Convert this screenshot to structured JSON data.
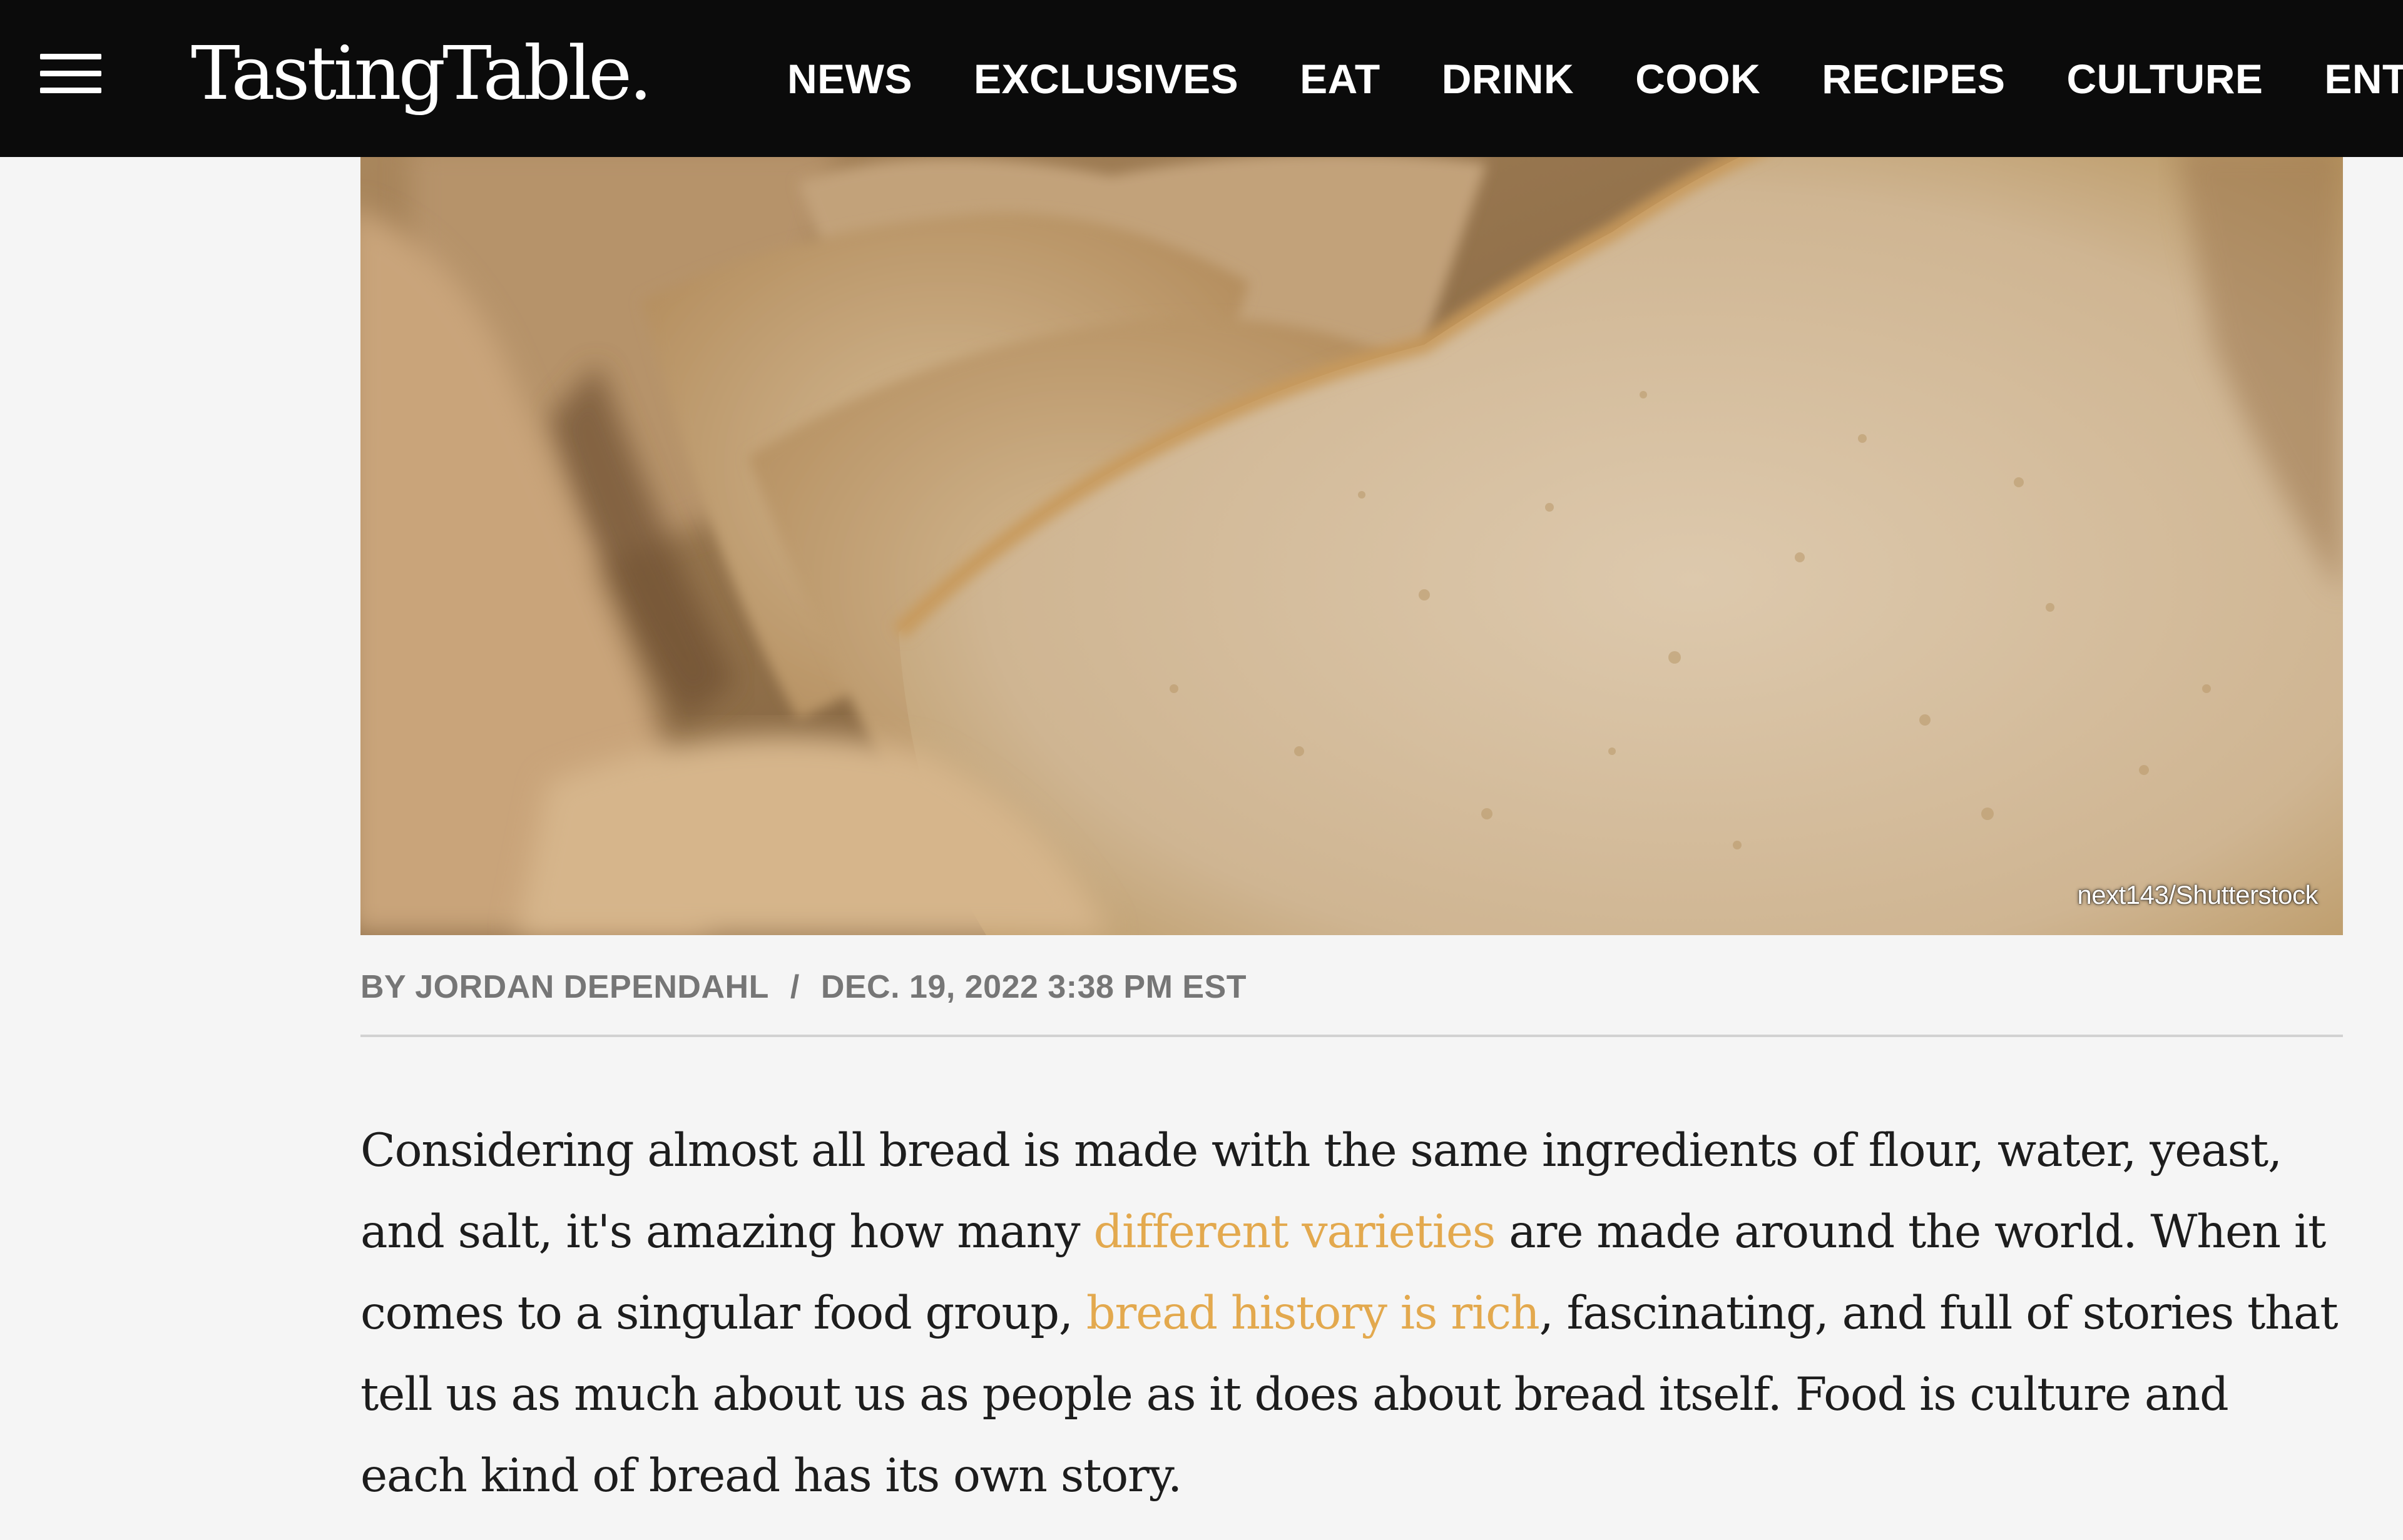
{
  "header": {
    "logo": "TastingTable.",
    "nav": [
      "NEWS",
      "EXCLUSIVES",
      "EAT",
      "DRINK",
      "COOK",
      "RECIPES",
      "CULTURE",
      "ENTERTA"
    ]
  },
  "hero": {
    "photo_credit": "next143/Shutterstock"
  },
  "byline": {
    "author": "BY JORDAN DEPENDAHL",
    "separator": "/",
    "date": "DEC. 19, 2022 3:38 PM EST"
  },
  "article": {
    "p1_part1": "Considering almost all bread is made with the same ingredients of flour, water, yeast, and salt, it's amazing how many ",
    "link1": "different varieties",
    "p1_part2": " are made around the world. When it comes to a singular food group, ",
    "link2": "bread history is rich",
    "p1_part3": ", fascinating, and full of stories that tell us as much about us as people as it does about bread itself. Food is culture and each kind of bread has its own story."
  },
  "colors": {
    "topbar": "#0b0b0b",
    "background": "#f5f5f5",
    "link": "#e3a94e",
    "byline": "#767676"
  }
}
